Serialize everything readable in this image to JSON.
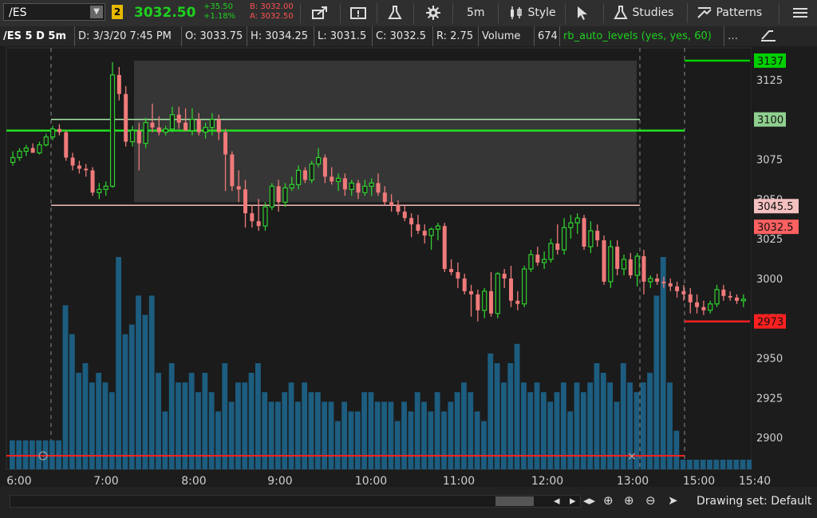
{
  "toolbar": {
    "symbol": "/ES",
    "link_badge": "2",
    "last_price": "3032.50",
    "net_change": "+35.50",
    "pct_change": "+1.18%",
    "bid": "B: 3032.00",
    "ask": "A: 3032.50",
    "timeframe": "5m",
    "style_label": "Style",
    "studies_label": "Studies",
    "patterns_label": "Patterns",
    "colors": {
      "up": "#1fd01f",
      "down": "#ff5050"
    }
  },
  "header": {
    "symbol_period": "/ES 5 D 5m",
    "date": "D: 3/3/20 7:45 PM",
    "open": "O: 3033.75",
    "high": "H: 3034.25",
    "low": "L: 3031.5",
    "close": "C: 3032.5",
    "range": "R: 2.75",
    "volume_label": "Volume",
    "volume_value": "674",
    "study": "rb_auto_levels (yes, yes, 60)"
  },
  "chart_data": {
    "type": "candlestick",
    "x_ticks": [
      "6:00",
      "7:00",
      "8:00",
      "9:00",
      "10:00",
      "11:00",
      "12:00",
      "13:00",
      "15:00",
      "15:40"
    ],
    "y_ticks": [
      2900,
      2925,
      2950,
      2975,
      3000,
      3025,
      3050,
      3075,
      3100,
      3125
    ],
    "ylim": [
      2880,
      3145
    ],
    "price_labels": [
      {
        "text": "3137",
        "value": 3137,
        "color": "#00d000"
      },
      {
        "text": "3100",
        "value": 3100,
        "color": "#8fd08f"
      },
      {
        "text": "3045.5",
        "value": 3045.5,
        "color": "#f4c0c0"
      },
      {
        "text": "3032.5",
        "value": 3032.5,
        "color": "#ff6060"
      },
      {
        "text": "2973",
        "value": 2973,
        "color": "#ff2020"
      }
    ],
    "levels": [
      {
        "value": 3093,
        "color": "#22e022"
      },
      {
        "value": 3100,
        "color": "#a6e8a6"
      },
      {
        "value": 3046,
        "color": "#f2b8b8"
      },
      {
        "value": 3137,
        "color": "#00d000"
      },
      {
        "value": 2973,
        "color": "#ff2020"
      }
    ],
    "candles": [
      [
        3073,
        3080,
        3071,
        3076
      ],
      [
        3076,
        3082,
        3074,
        3080
      ],
      [
        3080,
        3084,
        3077,
        3082
      ],
      [
        3082,
        3085,
        3079,
        3079
      ],
      [
        3079,
        3086,
        3078,
        3084
      ],
      [
        3084,
        3091,
        3083,
        3089
      ],
      [
        3089,
        3096,
        3087,
        3094
      ],
      [
        3094,
        3097,
        3090,
        3092
      ],
      [
        3092,
        3093,
        3074,
        3076
      ],
      [
        3076,
        3079,
        3068,
        3071
      ],
      [
        3071,
        3074,
        3066,
        3069
      ],
      [
        3069,
        3072,
        3064,
        3068
      ],
      [
        3068,
        3070,
        3052,
        3054
      ],
      [
        3054,
        3060,
        3050,
        3056
      ],
      [
        3056,
        3061,
        3052,
        3058
      ],
      [
        3058,
        3136,
        3057,
        3128
      ],
      [
        3128,
        3133,
        3112,
        3116
      ],
      [
        3116,
        3121,
        3083,
        3086
      ],
      [
        3086,
        3096,
        3083,
        3093
      ],
      [
        3093,
        3098,
        3068,
        3085
      ],
      [
        3085,
        3101,
        3082,
        3098
      ],
      [
        3098,
        3110,
        3092,
        3095
      ],
      [
        3095,
        3102,
        3090,
        3092
      ],
      [
        3092,
        3096,
        3090,
        3094
      ],
      [
        3094,
        3108,
        3092,
        3103
      ],
      [
        3103,
        3108,
        3094,
        3098
      ],
      [
        3098,
        3107,
        3094,
        3093
      ],
      [
        3093,
        3107,
        3090,
        3100
      ],
      [
        3100,
        3104,
        3090,
        3092
      ],
      [
        3092,
        3098,
        3088,
        3095
      ],
      [
        3095,
        3104,
        3090,
        3100
      ],
      [
        3100,
        3103,
        3087,
        3092
      ],
      [
        3092,
        3094,
        3055,
        3078
      ],
      [
        3078,
        3080,
        3055,
        3058
      ],
      [
        3058,
        3068,
        3048,
        3056
      ],
      [
        3056,
        3062,
        3032,
        3041
      ],
      [
        3041,
        3046,
        3032,
        3036
      ],
      [
        3036,
        3050,
        3030,
        3033
      ],
      [
        3033,
        3048,
        3030,
        3045
      ],
      [
        3045,
        3060,
        3043,
        3058
      ],
      [
        3058,
        3062,
        3042,
        3048
      ],
      [
        3048,
        3060,
        3045,
        3057
      ],
      [
        3057,
        3064,
        3055,
        3059
      ],
      [
        3059,
        3071,
        3056,
        3068
      ],
      [
        3068,
        3070,
        3060,
        3062
      ],
      [
        3062,
        3074,
        3060,
        3072
      ],
      [
        3072,
        3082,
        3070,
        3076
      ],
      [
        3076,
        3078,
        3060,
        3064
      ],
      [
        3064,
        3070,
        3059,
        3061
      ],
      [
        3061,
        3066,
        3055,
        3063
      ],
      [
        3063,
        3066,
        3052,
        3056
      ],
      [
        3056,
        3062,
        3052,
        3060
      ],
      [
        3060,
        3062,
        3050,
        3054
      ],
      [
        3054,
        3062,
        3052,
        3058
      ],
      [
        3058,
        3063,
        3052,
        3060
      ],
      [
        3060,
        3066,
        3052,
        3054
      ],
      [
        3054,
        3058,
        3046,
        3048
      ],
      [
        3048,
        3053,
        3042,
        3046
      ],
      [
        3046,
        3049,
        3040,
        3042
      ],
      [
        3042,
        3046,
        3036,
        3038
      ],
      [
        3038,
        3041,
        3026,
        3034
      ],
      [
        3034,
        3040,
        3028,
        3030
      ],
      [
        3030,
        3034,
        3022,
        3027
      ],
      [
        3027,
        3032,
        3018,
        3031
      ],
      [
        3031,
        3035,
        3024,
        3033
      ],
      [
        3033,
        3035,
        3004,
        3006
      ],
      [
        3006,
        3012,
        3002,
        3004
      ],
      [
        3004,
        3010,
        2994,
        3000
      ],
      [
        3000,
        3003,
        2990,
        2992
      ],
      [
        2992,
        2996,
        2976,
        2990
      ],
      [
        2990,
        2993,
        2973,
        2980
      ],
      [
        2980,
        2994,
        2975,
        2992
      ],
      [
        2992,
        3004,
        2976,
        2978
      ],
      [
        2978,
        3004,
        2975,
        3003
      ],
      [
        3003,
        3006,
        2994,
        3000
      ],
      [
        3000,
        3008,
        2982,
        2986
      ],
      [
        2986,
        2992,
        2980,
        2984
      ],
      [
        2984,
        3008,
        2982,
        3006
      ],
      [
        3006,
        3018,
        3004,
        3015
      ],
      [
        3015,
        3020,
        3008,
        3010
      ],
      [
        3010,
        3017,
        3006,
        3012
      ],
      [
        3012,
        3025,
        3010,
        3022
      ],
      [
        3022,
        3034,
        3015,
        3018
      ],
      [
        3018,
        3038,
        3015,
        3032
      ],
      [
        3032,
        3040,
        3025,
        3035
      ],
      [
        3035,
        3041,
        3028,
        3038
      ],
      [
        3038,
        3040,
        3018,
        3020
      ],
      [
        3020,
        3036,
        3016,
        3030
      ],
      [
        3030,
        3034,
        3020,
        3024
      ],
      [
        3024,
        3027,
        2996,
        2998
      ],
      [
        2998,
        3024,
        2994,
        3020
      ],
      [
        3020,
        3024,
        3002,
        3006
      ],
      [
        3006,
        3015,
        3002,
        3012
      ],
      [
        3012,
        3016,
        3000,
        3002
      ],
      [
        3002,
        3016,
        2995,
        3014
      ],
      [
        3014,
        3018,
        2990,
        2998
      ],
      [
        2998,
        3002,
        2994,
        3000
      ],
      [
        3000,
        3003,
        2996,
        2998
      ],
      [
        2998,
        3001,
        2994,
        2997
      ],
      [
        2997,
        3000,
        2992,
        2995
      ],
      [
        2995,
        2998,
        2988,
        2992
      ],
      [
        2992,
        2996,
        2986,
        2990
      ],
      [
        2990,
        2994,
        2978,
        2985
      ],
      [
        2985,
        2990,
        2978,
        2982
      ],
      [
        2982,
        2986,
        2977,
        2980
      ],
      [
        2980,
        2986,
        2978,
        2984
      ],
      [
        2984,
        2996,
        2982,
        2993
      ],
      [
        2993,
        2996,
        2986,
        2989
      ],
      [
        2989,
        2992,
        2986,
        2988
      ],
      [
        2988,
        2990,
        2984,
        2986
      ],
      [
        2986,
        2990,
        2982,
        2987
      ]
    ],
    "volumes": [
      3,
      3,
      3,
      3,
      3,
      3,
      3,
      3,
      17,
      14,
      10,
      11,
      9,
      10,
      9,
      8,
      22,
      14,
      15,
      18,
      16,
      18,
      10,
      6,
      11,
      9,
      9,
      10,
      8,
      10,
      8,
      6,
      11,
      7,
      9,
      9,
      10,
      11,
      8,
      7,
      7,
      8,
      9,
      7,
      9,
      8,
      8,
      7,
      7,
      5,
      7,
      6,
      6,
      8,
      8,
      7,
      7,
      7,
      5,
      7,
      6,
      8,
      7,
      6,
      8,
      6,
      7,
      8,
      9,
      8,
      6,
      5,
      12,
      11,
      9,
      11,
      13,
      9,
      8,
      9,
      8,
      7,
      8,
      9,
      6,
      9,
      8,
      9,
      11,
      10,
      9,
      7,
      11,
      9,
      8,
      9,
      10,
      18,
      22,
      9,
      4,
      1,
      1,
      1,
      1,
      1,
      1,
      1,
      1,
      1,
      1,
      1,
      1,
      1
    ],
    "candles_bar_width": 5
  },
  "status_bar": {
    "drawing_set": "Drawing set: Default"
  }
}
